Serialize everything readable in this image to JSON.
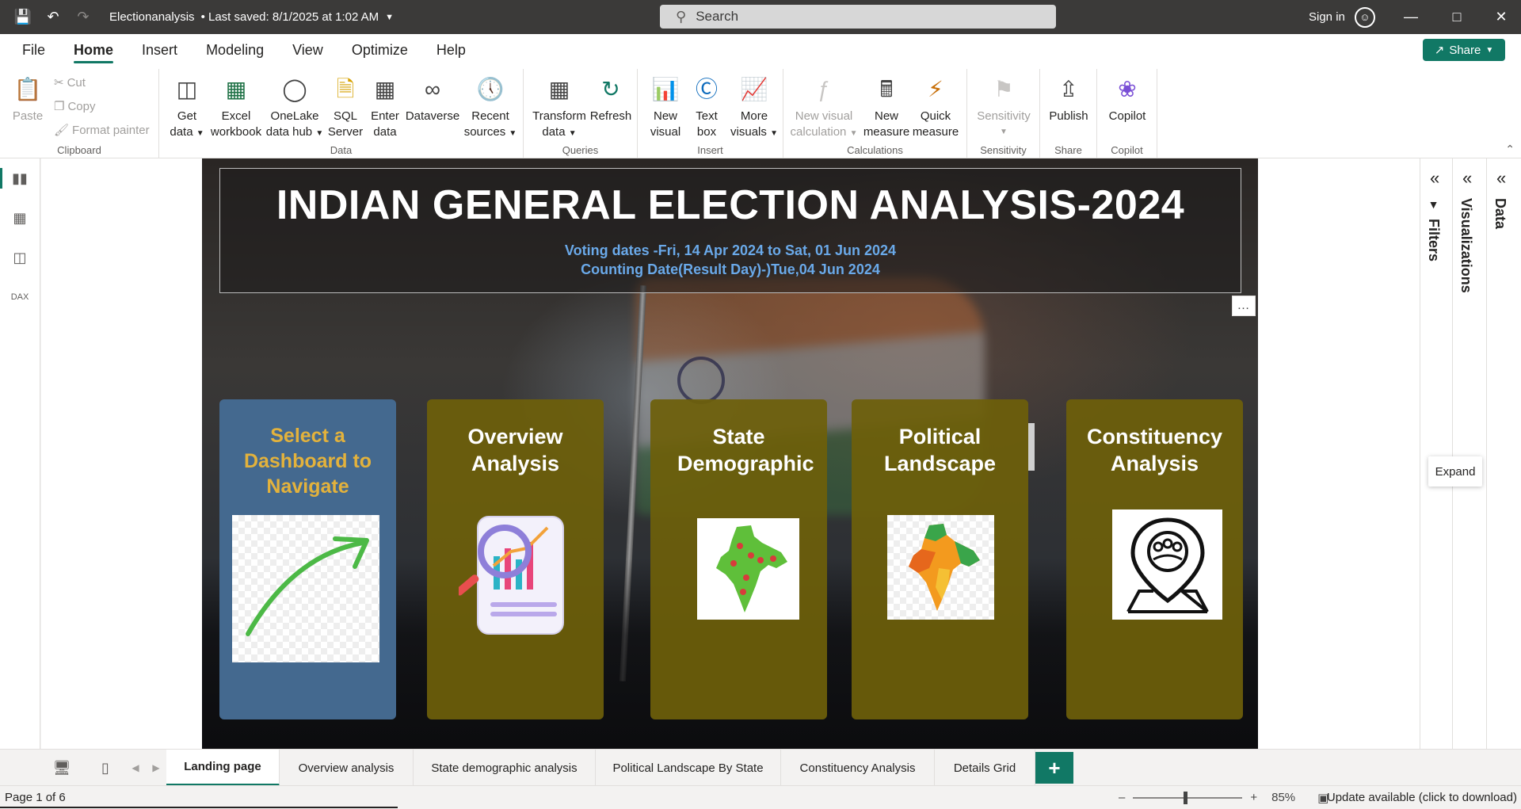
{
  "titlebar": {
    "doc_name": "Electionanalysis",
    "saved_status": "• Last saved: 8/1/2025 at 1:02 AM",
    "search_placeholder": "Search",
    "sign_in": "Sign in"
  },
  "menu": {
    "tabs": [
      "File",
      "Home",
      "Insert",
      "Modeling",
      "View",
      "Optimize",
      "Help"
    ],
    "active": "Home",
    "share": "Share"
  },
  "ribbon": {
    "clipboard": {
      "paste": "Paste",
      "cut": "Cut",
      "copy": "Copy",
      "format_painter": "Format painter",
      "label": "Clipboard"
    },
    "data": {
      "label": "Data",
      "get_data": [
        "Get",
        "data"
      ],
      "excel": [
        "Excel",
        "workbook"
      ],
      "onelake": [
        "OneLake",
        "data hub"
      ],
      "sql": [
        "SQL",
        "Server"
      ],
      "enter": [
        "Enter",
        "data"
      ],
      "dataverse": "Dataverse",
      "recent": [
        "Recent",
        "sources"
      ]
    },
    "queries": {
      "label": "Queries",
      "transform": [
        "Transform",
        "data"
      ],
      "refresh": "Refresh"
    },
    "insert": {
      "label": "Insert",
      "new_visual": [
        "New",
        "visual"
      ],
      "text_box": [
        "Text",
        "box"
      ],
      "more_visuals": [
        "More",
        "visuals"
      ]
    },
    "calculations": {
      "label": "Calculations",
      "new_visual_calc": [
        "New visual",
        "calculation"
      ],
      "new_measure": [
        "New",
        "measure"
      ],
      "quick_measure": [
        "Quick",
        "measure"
      ]
    },
    "sensitivity": {
      "label": "Sensitivity",
      "button": "Sensitivity"
    },
    "share": {
      "label": "Share",
      "publish": "Publish"
    },
    "copilot": {
      "label": "Copilot",
      "button": "Copilot"
    }
  },
  "report": {
    "title": "INDIAN GENERAL ELECTION ANALYSIS-2024",
    "voting_dates": "Voting dates -Fri, 14 Apr 2024 to Sat, 01 Jun 2024",
    "counting_date": "Counting Date(Result Day)-)Tue,04 Jun 2024",
    "cards": [
      {
        "title": "Select a Dashboard to Navigate",
        "icon": "arrow-icon"
      },
      {
        "title": "Overview Analysis",
        "icon": "magnifier-chart-icon"
      },
      {
        "title": "State Demographic",
        "icon": "india-map-pins-icon"
      },
      {
        "title": "Political Landscape by",
        "icon": "india-map-states-icon"
      },
      {
        "title": "Constituency Analysis",
        "icon": "location-people-icon"
      }
    ]
  },
  "panes": {
    "filters": "Filters",
    "visualizations": "Visualizations",
    "data": "Data",
    "expand_tip": "Expand"
  },
  "pages": {
    "tabs": [
      "Landing page",
      "Overview analysis",
      "State demographic analysis",
      "Political Landscape By State",
      "Constituency Analysis",
      "Details Grid"
    ],
    "active": "Landing page"
  },
  "status": {
    "page_count": "Page 1 of 6",
    "zoom": "85%",
    "update": "Update available (click to download)"
  },
  "colors": {
    "accent": "#117865",
    "title_bar": "#3b3a39",
    "card_gold": "#6e5f0a",
    "card_blue": "#44698f",
    "date_blue": "#6aa9e9"
  }
}
